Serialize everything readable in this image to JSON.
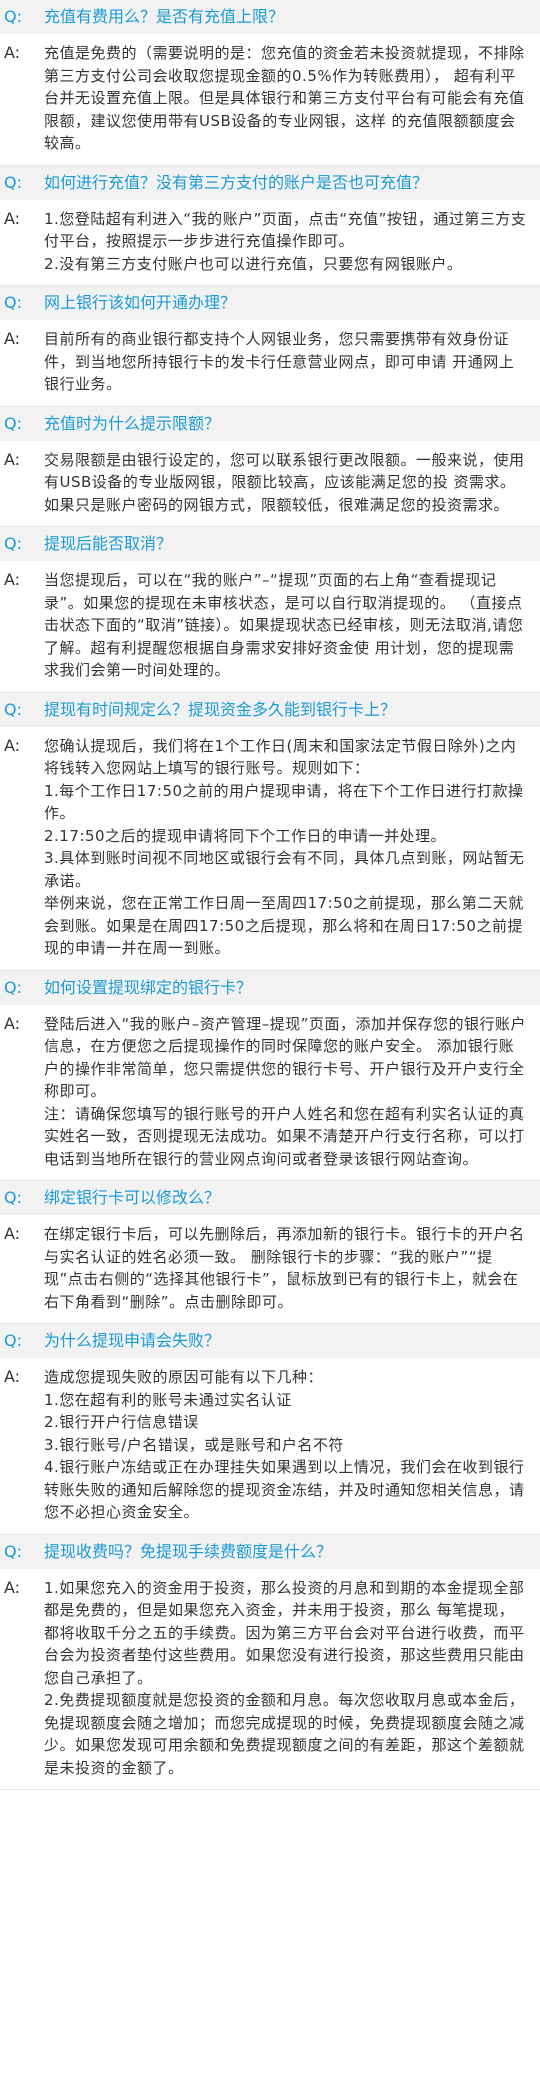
{
  "labels": {
    "q": "Q:",
    "a": "A:"
  },
  "faq": [
    {
      "q": "充值有费用么？是否有充值上限？",
      "a": [
        "充值是免费的（需要说明的是：您充值的资金若未投资就提现，不排除第三方支付公司会收取您提现金额的0.5%作为转账费用），  超有利平台并无设置充值上限。但是具体银行和第三方支付平台有可能会有充值限额，建议您使用带有USB设备的专业网银，这样 的充值限额额度会较高。"
      ]
    },
    {
      "q": "如何进行充值？没有第三方支付的账户是否也可充值？",
      "a": [
        "1.您登陆超有利进入“我的账户”页面，点击“充值”按钮，通过第三方支付平台，按照提示一步步进行充值操作即可。",
        "2.没有第三方支付账户也可以进行充值，只要您有网银账户。"
      ]
    },
    {
      "q": "网上银行该如何开通办理？",
      "a": [
        "目前所有的商业银行都支持个人网银业务，您只需要携带有效身份证件，到当地您所持银行卡的发卡行任意营业网点，即可申请 开通网上银行业务。"
      ]
    },
    {
      "q": "充值时为什么提示限额？",
      "a": [
        "交易限额是由银行设定的，您可以联系银行更改限额。一般来说，使用有USB设备的专业版网银，限额比较高，应该能满足您的投 资需求。如果只是账户密码的网银方式，限额较低，很难满足您的投资需求。"
      ]
    },
    {
      "q": "提现后能否取消？",
      "a": [
        "当您提现后，可以在“我的账户”–“提现”页面的右上角“查看提现记录”。如果您的提现在未审核状态，是可以自行取消提现的。  （直接点击状态下面的“取消”链接）。如果提现状态已经审核，则无法取消,请您了解。超有利提醒您根据自身需求安排好资金使 用计划，您的提现需求我们会第一时间处理的。"
      ]
    },
    {
      "q": "提现有时间规定么？提现资金多久能到银行卡上？",
      "a": [
        "您确认提现后，我们将在1个工作日(周末和国家法定节假日除外)之内将钱转入您网站上填写的银行账号。规则如下：",
        "1.每个工作日17:50之前的用户提现申请，将在下个工作日进行打款操作。",
        "2.17:50之后的提现申请将同下个工作日的申请一并处理。",
        "3.具体到账时间视不同地区或银行会有不同，具体几点到账，网站暂无承诺。",
        "举例来说，您在正常工作日周一至周四17:50之前提现，那么第二天就会到账。如果是在周四17:50之后提现，那么将和在周日17:50之前提现的申请一并在周一到账。"
      ]
    },
    {
      "q": "如何设置提现绑定的银行卡？",
      "a": [
        "登陆后进入“我的账户–资产管理–提现”页面，添加并保存您的银行账户信息，在方便您之后提现操作的同时保障您的账户安全。 添加银行账户的操作非常简单，您只需提供您的银行卡号、开户银行及开户支行全称即可。",
        "注：请确保您填写的银行账号的开户人姓名和您在超有利实名认证的真实姓名一致，否则提现无法成功。如果不清楚开户行支行名称，可以打电话到当地所在银行的营业网点询问或者登录该银行网站查询。"
      ]
    },
    {
      "q": "绑定银行卡可以修改么？",
      "a": [
        "在绑定银行卡后，可以先删除后，再添加新的银行卡。银行卡的开户名与实名认证的姓名必须一致。 删除银行卡的步骤：“我的账户”“提现”点击右侧的“选择其他银行卡”，鼠标放到已有的银行卡上，就会在右下角看到“删除”。点击删除即可。"
      ]
    },
    {
      "q": "为什么提现申请会失败？",
      "a": [
        "造成您提现失败的原因可能有以下几种：",
        "1.您在超有利的账号未通过实名认证",
        "2.银行开户行信息错误",
        "3.银行账号/户名错误，或是账号和户名不符",
        "4.银行账户冻结或正在办理挂失如果遇到以上情况，我们会在收到银行转账失败的通知后解除您的提现资金冻结，并及时通知您相关信息，请您不必担心资金安全。"
      ]
    },
    {
      "q": "提现收费吗？免提现手续费额度是什么？",
      "a": [
        "1.如果您充入的资金用于投资，那么投资的月息和到期的本金提现全部都是免费的，但是如果您充入资金，并未用于投资，那么 每笔提现，都将收取千分之五的手续费。因为第三方平台会对平台进行收费，而平台会为投资者垫付这些费用。如果您没有进行投资，那这些费用只能由您自己承担了。",
        "2.免费提现额度就是您投资的金额和月息。每次您收取月息或本金后，免提现额度会随之增加；而您完成提现的时候，免费提现额度会随之减少。如果您发现可用余额和免费提现额度之间的有差距，那这个差额就是未投资的金额了。"
      ]
    }
  ]
}
